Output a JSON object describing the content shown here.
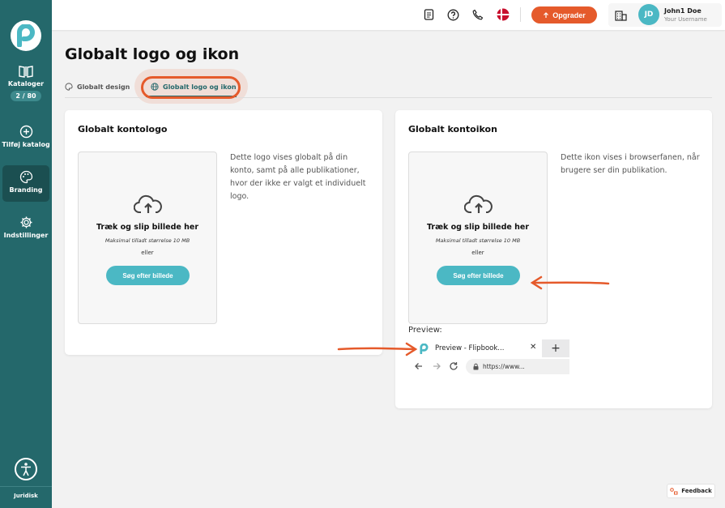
{
  "sidebar": {
    "items": [
      {
        "label": "Kataloger",
        "badge": "2 / 80",
        "icon": "book-icon"
      },
      {
        "label": "Tilføj katalog",
        "icon": "plus-circle-icon"
      },
      {
        "label": "Branding",
        "icon": "palette-icon"
      },
      {
        "label": "Indstillinger",
        "icon": "gear-icon"
      }
    ],
    "active": "Branding",
    "footer_label": "Juridisk"
  },
  "topbar": {
    "upgrade_label": "Opgrader",
    "user_initials": "JD",
    "user_name": "John1 Doe",
    "user_sub": "Your Username"
  },
  "page": {
    "title": "Globalt logo og ikon",
    "tabs": [
      {
        "label": "Globalt design",
        "icon": "palette-icon"
      },
      {
        "label": "Globalt logo og ikon",
        "icon": "globe-icon",
        "active": true
      }
    ]
  },
  "cards": [
    {
      "title": "Globalt kontologo",
      "drop_title": "Træk og slip billede her",
      "drop_sub": "Maksimal tilladt størrelse 10 MB",
      "drop_or": "eller",
      "button": "Søg efter billede",
      "description": "Dette logo vises globalt på din konto, samt på alle publikationer, hvor der ikke er valgt et individuelt logo."
    },
    {
      "title": "Globalt kontoikon",
      "drop_title": "Træk og slip billede her",
      "drop_sub": "Maksimal tilladt størrelse 10 MB",
      "drop_or": "eller",
      "button": "Søg efter billede",
      "description": "Dette ikon vises i browserfanen, når brugere ser din publikation.",
      "preview_label": "Preview:",
      "preview_tab_title": "Preview - Flipbook...",
      "preview_url": "https://www..."
    }
  ],
  "feedback_label": "Feedback",
  "colors": {
    "sidebar": "#24686b",
    "accent": "#e55a2b",
    "button": "#4bb8c4"
  }
}
